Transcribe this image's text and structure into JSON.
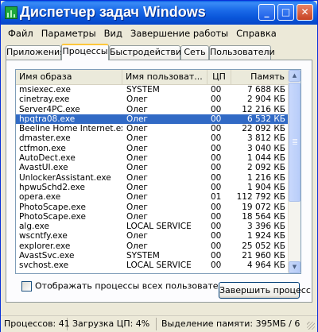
{
  "window": {
    "title": "Диспетчер задач Windows",
    "controls": {
      "minimize": "_",
      "maximize": "□",
      "close": "✕"
    }
  },
  "menu": [
    "Файл",
    "Параметры",
    "Вид",
    "Завершение работы",
    "Справка"
  ],
  "tabs": [
    "Приложения",
    "Процессы",
    "Быстродействие",
    "Сеть",
    "Пользователи"
  ],
  "active_tab": "Процессы",
  "table": {
    "columns": [
      "Имя образа",
      "Имя пользоват...",
      "ЦП",
      "Память"
    ],
    "rows": [
      {
        "name": "msiexec.exe",
        "user": "SYSTEM",
        "cpu": "00",
        "mem": "7 688 КБ"
      },
      {
        "name": "cinetray.exe",
        "user": "Олег",
        "cpu": "00",
        "mem": "2 904 КБ"
      },
      {
        "name": "Server4PC.exe",
        "user": "Олег",
        "cpu": "00",
        "mem": "12 216 КБ"
      },
      {
        "name": "hpqtra08.exe",
        "user": "Олег",
        "cpu": "00",
        "mem": "6 532 КБ",
        "selected": true
      },
      {
        "name": "Beeline Home Internet.exe",
        "user": "Олег",
        "cpu": "00",
        "mem": "22 092 КБ"
      },
      {
        "name": "dmaster.exe",
        "user": "Олег",
        "cpu": "00",
        "mem": "3 812 КБ"
      },
      {
        "name": "ctfmon.exe",
        "user": "Олег",
        "cpu": "00",
        "mem": "3 040 КБ"
      },
      {
        "name": "AutoDect.exe",
        "user": "Олег",
        "cpu": "00",
        "mem": "1 044 КБ"
      },
      {
        "name": "AvastUI.exe",
        "user": "Олег",
        "cpu": "00",
        "mem": "2 092 КБ"
      },
      {
        "name": "UnlockerAssistant.exe",
        "user": "Олег",
        "cpu": "00",
        "mem": "1 216 КБ"
      },
      {
        "name": "hpwuSchd2.exe",
        "user": "Олег",
        "cpu": "00",
        "mem": "1 904 КБ"
      },
      {
        "name": "opera.exe",
        "user": "Олег",
        "cpu": "01",
        "mem": "112 792 КБ"
      },
      {
        "name": "PhotoScape.exe",
        "user": "Олег",
        "cpu": "00",
        "mem": "19 072 КБ"
      },
      {
        "name": "PhotoScape.exe",
        "user": "Олег",
        "cpu": "00",
        "mem": "18 564 КБ"
      },
      {
        "name": "alg.exe",
        "user": "LOCAL SERVICE",
        "cpu": "00",
        "mem": "3 396 КБ"
      },
      {
        "name": "wscntfy.exe",
        "user": "Олег",
        "cpu": "00",
        "mem": "1 924 КБ"
      },
      {
        "name": "explorer.exe",
        "user": "Олег",
        "cpu": "00",
        "mem": "25 052 КБ"
      },
      {
        "name": "AvastSvc.exe",
        "user": "SYSTEM",
        "cpu": "00",
        "mem": "21 960 КБ"
      },
      {
        "name": "svchost.exe",
        "user": "LOCAL SERVICE",
        "cpu": "00",
        "mem": "4 964 КБ"
      }
    ]
  },
  "show_all_label": "Отображать процессы всех пользователей",
  "end_process_label": "Завершить процесс",
  "status": {
    "processes": "Процессов: 41",
    "cpu": "Загрузка ЦП: 4%",
    "memory": "Выделение памяти: 395МБ / 6"
  },
  "colors": {
    "selection": "#316AC5",
    "title_bar": "#0A56DA",
    "window_bg": "#ECE9D8"
  }
}
